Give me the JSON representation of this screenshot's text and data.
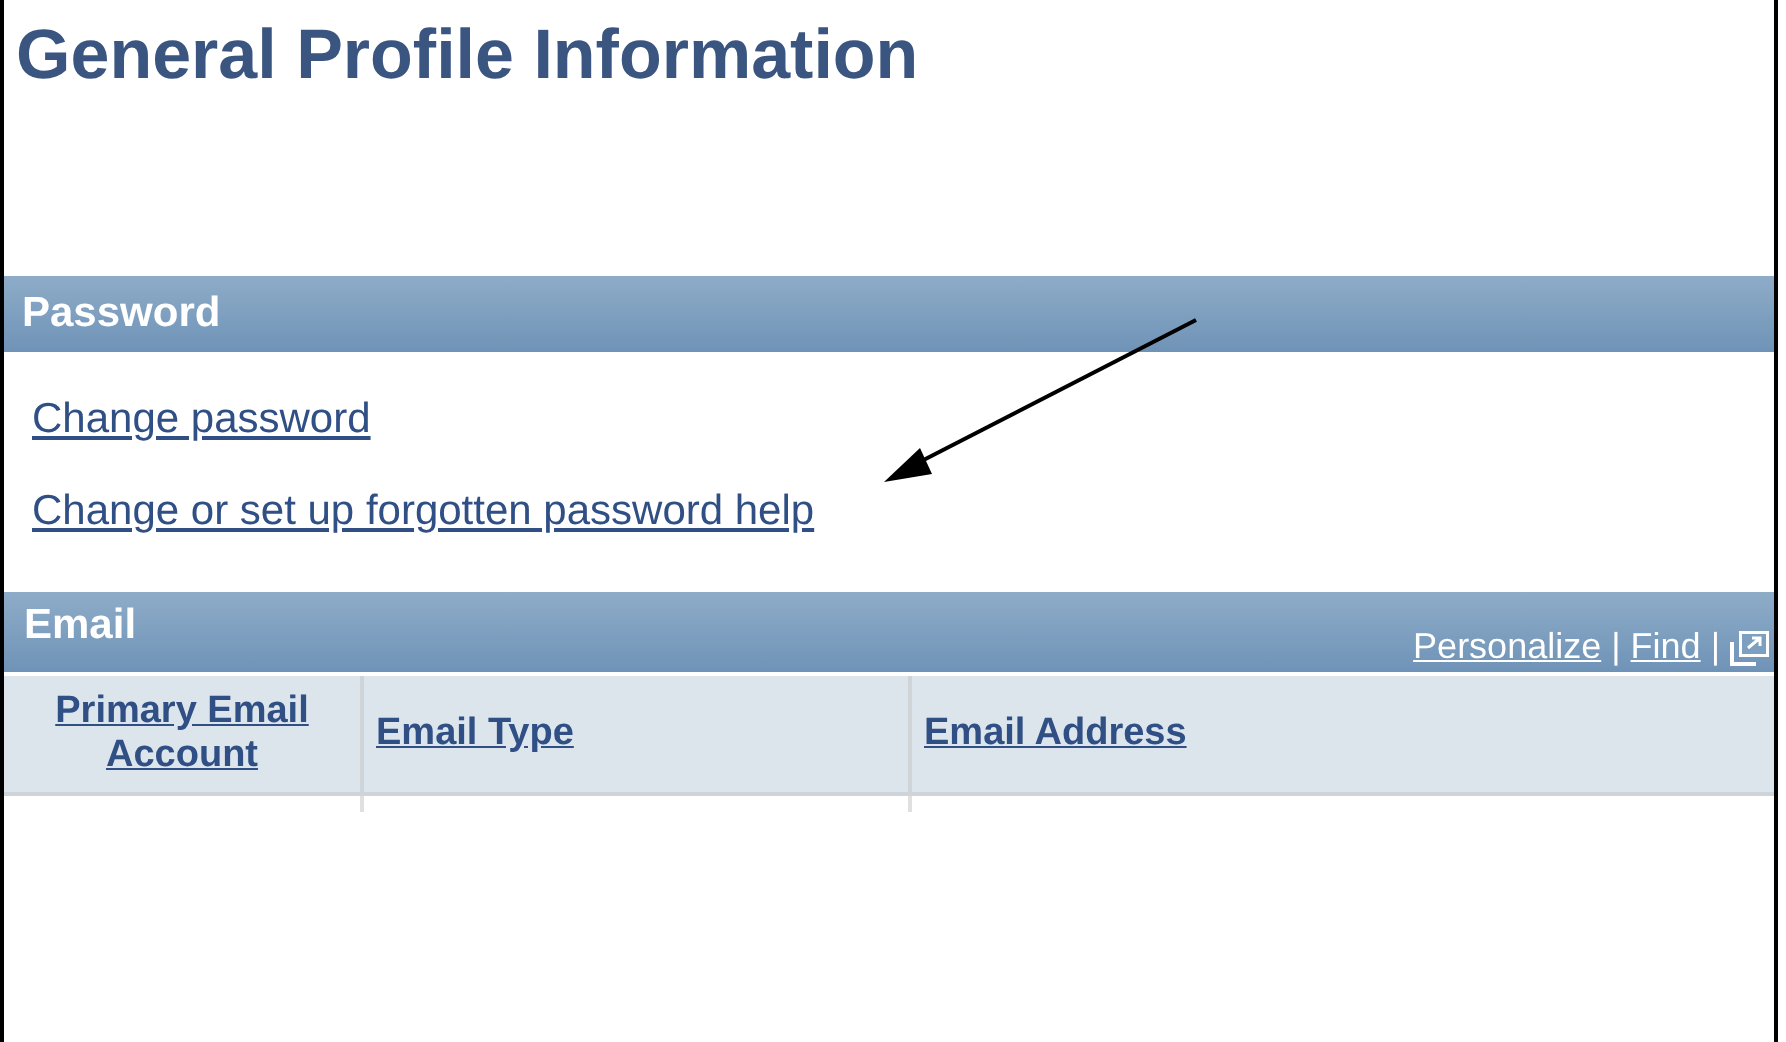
{
  "title": "General Profile Information",
  "password": {
    "header": "Password",
    "links": [
      "Change password",
      "Change or set up forgotten password help"
    ]
  },
  "email": {
    "header": "Email",
    "tools": [
      {
        "label": "Personalize",
        "separator": "|"
      },
      {
        "label": "Find",
        "separator": "|"
      }
    ],
    "columns": [
      {
        "label": "Primary Email Account"
      },
      {
        "label": "Email Type"
      },
      {
        "label": "Email Address"
      }
    ]
  }
}
